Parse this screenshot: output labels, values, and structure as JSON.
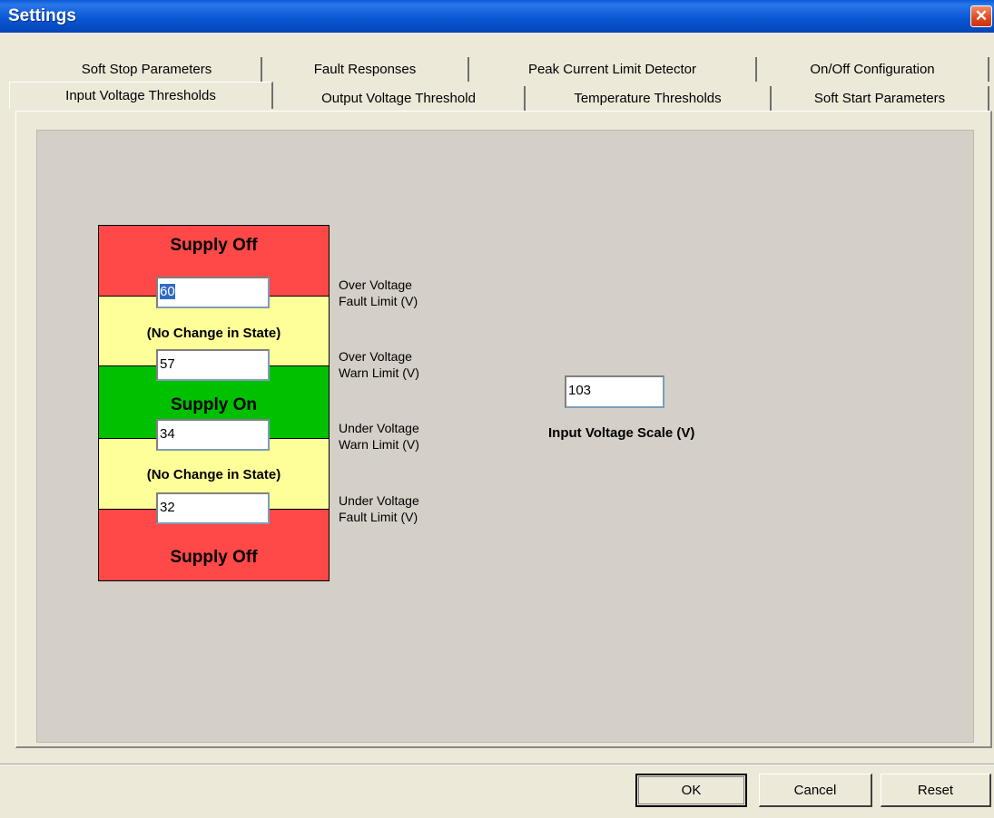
{
  "window": {
    "title": "Settings",
    "close_glyph": "✕"
  },
  "tabs_row_back": [
    {
      "label": "Soft Stop Parameters"
    },
    {
      "label": "Fault Responses"
    },
    {
      "label": "Peak Current Limit Detector"
    },
    {
      "label": "On/Off Configuration"
    }
  ],
  "tabs_row_front": [
    {
      "label": "Input Voltage Thresholds",
      "active": true
    },
    {
      "label": "Output Voltage Threshold"
    },
    {
      "label": "Temperature Thresholds"
    },
    {
      "label": "Soft Start Parameters"
    }
  ],
  "thresholds": {
    "band_supply_off_top": "Supply Off",
    "band_no_change_upper": "(No Change in State)",
    "band_supply_on": "Supply On",
    "band_no_change_lower": "(No Change in State)",
    "band_supply_off_bottom": "Supply Off",
    "ov_fault": {
      "value": "60",
      "label_line1": "Over Voltage",
      "label_line2": "Fault Limit (V)"
    },
    "ov_warn": {
      "value": "57",
      "label_line1": "Over Voltage",
      "label_line2": "Warn Limit (V)"
    },
    "uv_warn": {
      "value": "34",
      "label_line1": "Under Voltage",
      "label_line2": "Warn Limit (V)"
    },
    "uv_fault": {
      "value": "32",
      "label_line1": "Under Voltage",
      "label_line2": "Fault Limit (V)"
    }
  },
  "scale": {
    "value": "103",
    "label": "Input Voltage Scale (V)"
  },
  "buttons": {
    "ok": "OK",
    "cancel": "Cancel",
    "reset": "Reset"
  },
  "colors": {
    "red": "#ff4848",
    "yellow": "#ffff99",
    "green": "#00c000",
    "titlebar": "#0a5bd8"
  }
}
